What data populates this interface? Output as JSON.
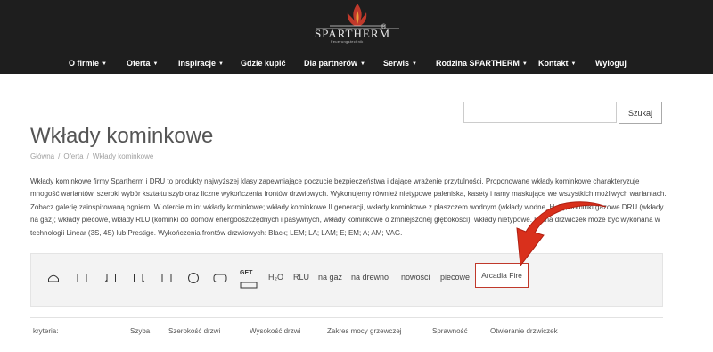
{
  "header": {
    "brand": "SPARTHERM",
    "registered": "®",
    "tagline": "Feuerungstechnik",
    "nav": [
      {
        "label": "O firmie",
        "dropdown": true
      },
      {
        "label": "Oferta",
        "dropdown": true
      },
      {
        "label": "Inspiracje",
        "dropdown": true
      },
      {
        "label": "Gdzie kupić",
        "dropdown": false
      },
      {
        "label": "Dla partnerów",
        "dropdown": true
      },
      {
        "label": "Serwis",
        "dropdown": true
      },
      {
        "label": "Rodzina SPARTHERM",
        "dropdown": true
      },
      {
        "label": "Kontakt",
        "dropdown": true
      },
      {
        "label": "Wyloguj",
        "dropdown": false
      }
    ],
    "colors": {
      "bar": "#1e1e1e",
      "flame": "#c0392b",
      "text": "#ffffff"
    }
  },
  "search": {
    "value": "",
    "placeholder": "",
    "button_label": "Szukaj"
  },
  "page": {
    "title": "Wkłady kominkowe",
    "breadcrumb": [
      "Główna",
      "Oferta",
      "Wkłady kominkowe"
    ],
    "description": "Wkłady kominkowe firmy Spartherm i DRU to produkty najwyższej klasy zapewniające poczucie bezpieczeństwa i dające wrażenie przytulności. Proponowane wkłady kominkowe charakteryzuje mnogość wariantów, szeroki wybór kształtu szyb oraz liczne wykończenia frontów drzwiowych. Wykonujemy również nietypowe paleniska, kasety i ramy maskujące we wszystkich możliwych wariantach. Zobacz galerię zainspirowaną ogniem. W ofercie m.in: wkłady kominkowe; wkłady kominkowe II generacji, wkłady kominkowe z płaszczem wodnym (wkłady wodne, H₂O); kominki gazowe DRU (wkłady na gaz); wkłady piecowe, wkłady RLU (kominki do domów energooszczędnych i pasywnych, wkłady kominkowe o zmniejszonej głębokości), wkłady nietypowe. Rama drzwiczek może być wykonana w technologii Linear (3S, 4S) lub Prestige. Wykończenia frontów drzwiowych: Black; LEM; LA; LAM; E; EM; A; AM; VAG."
  },
  "filters": {
    "icons": [
      "arch-glass-icon",
      "front-glass-icon",
      "corner-left-glass-icon",
      "corner-right-glass-icon",
      "three-sided-glass-icon",
      "round-glass-icon",
      "panorama-glass-icon",
      "get-icon"
    ],
    "get_label": "GET",
    "text_filters": [
      "H₂O",
      "RLU",
      "na gaz",
      "na drewno",
      "nowości",
      "piecowe"
    ],
    "highlighted": "Arcadia Fire",
    "highlight_color": "#c0392b"
  },
  "criteria": {
    "label": "kryteria:",
    "columns": [
      "Szyba",
      "Szerokość drzwi",
      "Wysokość drzwi",
      "Zakres mocy grzewczej",
      "Sprawność",
      "Otwieranie drzwiczek"
    ]
  },
  "annotation": {
    "arrow_color": "#d9301c"
  }
}
